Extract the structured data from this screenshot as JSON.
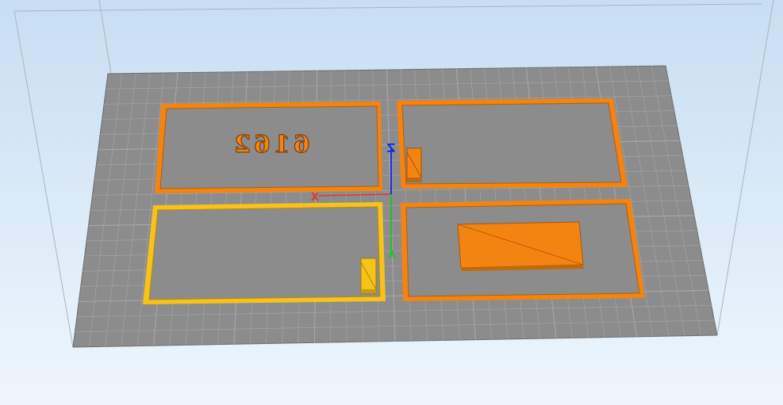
{
  "viewport": {
    "background_top": "#c7def2",
    "background_bottom": "#eef6fc",
    "bed_color": "#8c8c8c",
    "grid_line_color": "#a8a8a8",
    "bed_edge_color": "#6d6d6d",
    "build_volume_line_color": "#a9b4bd"
  },
  "axes": {
    "x_label": "X",
    "y_label": "Y",
    "z_label": "Z",
    "x_color": "#e0392b",
    "y_color": "#22c02a",
    "z_color": "#1830e0"
  },
  "objects": {
    "object_color": "#f48412",
    "selected_color": "#f8c21b",
    "embossed_text": "6162",
    "items": [
      {
        "name": "frame-top-left",
        "selected": false
      },
      {
        "name": "text-6162",
        "selected": false
      },
      {
        "name": "frame-top-right",
        "selected": false
      },
      {
        "name": "block-top-right",
        "selected": false
      },
      {
        "name": "frame-bottom-left",
        "selected": true
      },
      {
        "name": "block-bottom-left",
        "selected": true
      },
      {
        "name": "frame-bottom-right",
        "selected": false
      },
      {
        "name": "plate-bottom-right",
        "selected": false
      }
    ]
  }
}
